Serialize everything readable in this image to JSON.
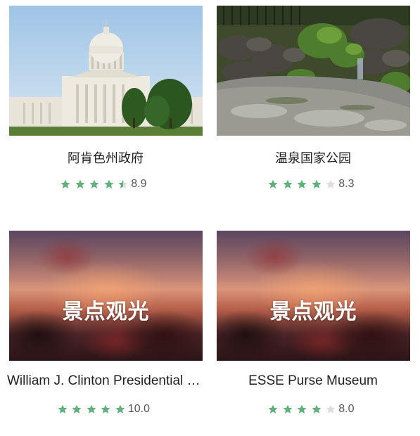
{
  "colors": {
    "star_filled": "#5fb07a",
    "star_empty": "#dddddd"
  },
  "cards": [
    {
      "name": "阿肯色州政府",
      "image": "arkansas-capitol-photo",
      "rating_stars": 4.5,
      "score": "8.9"
    },
    {
      "name": "温泉国家公园",
      "image": "hot-springs-rock-garden-photo",
      "rating_stars": 4,
      "score": "8.3"
    },
    {
      "name": "William J. Clinton Presidential Center and Park",
      "image": "placeholder-blurred-sunset",
      "image_label": "景点观光",
      "rating_stars": 5,
      "score": "10.0"
    },
    {
      "name": "ESSE Purse Museum",
      "image": "placeholder-blurred-sunset",
      "image_label": "景点观光",
      "rating_stars": 4,
      "score": "8.0"
    }
  ]
}
